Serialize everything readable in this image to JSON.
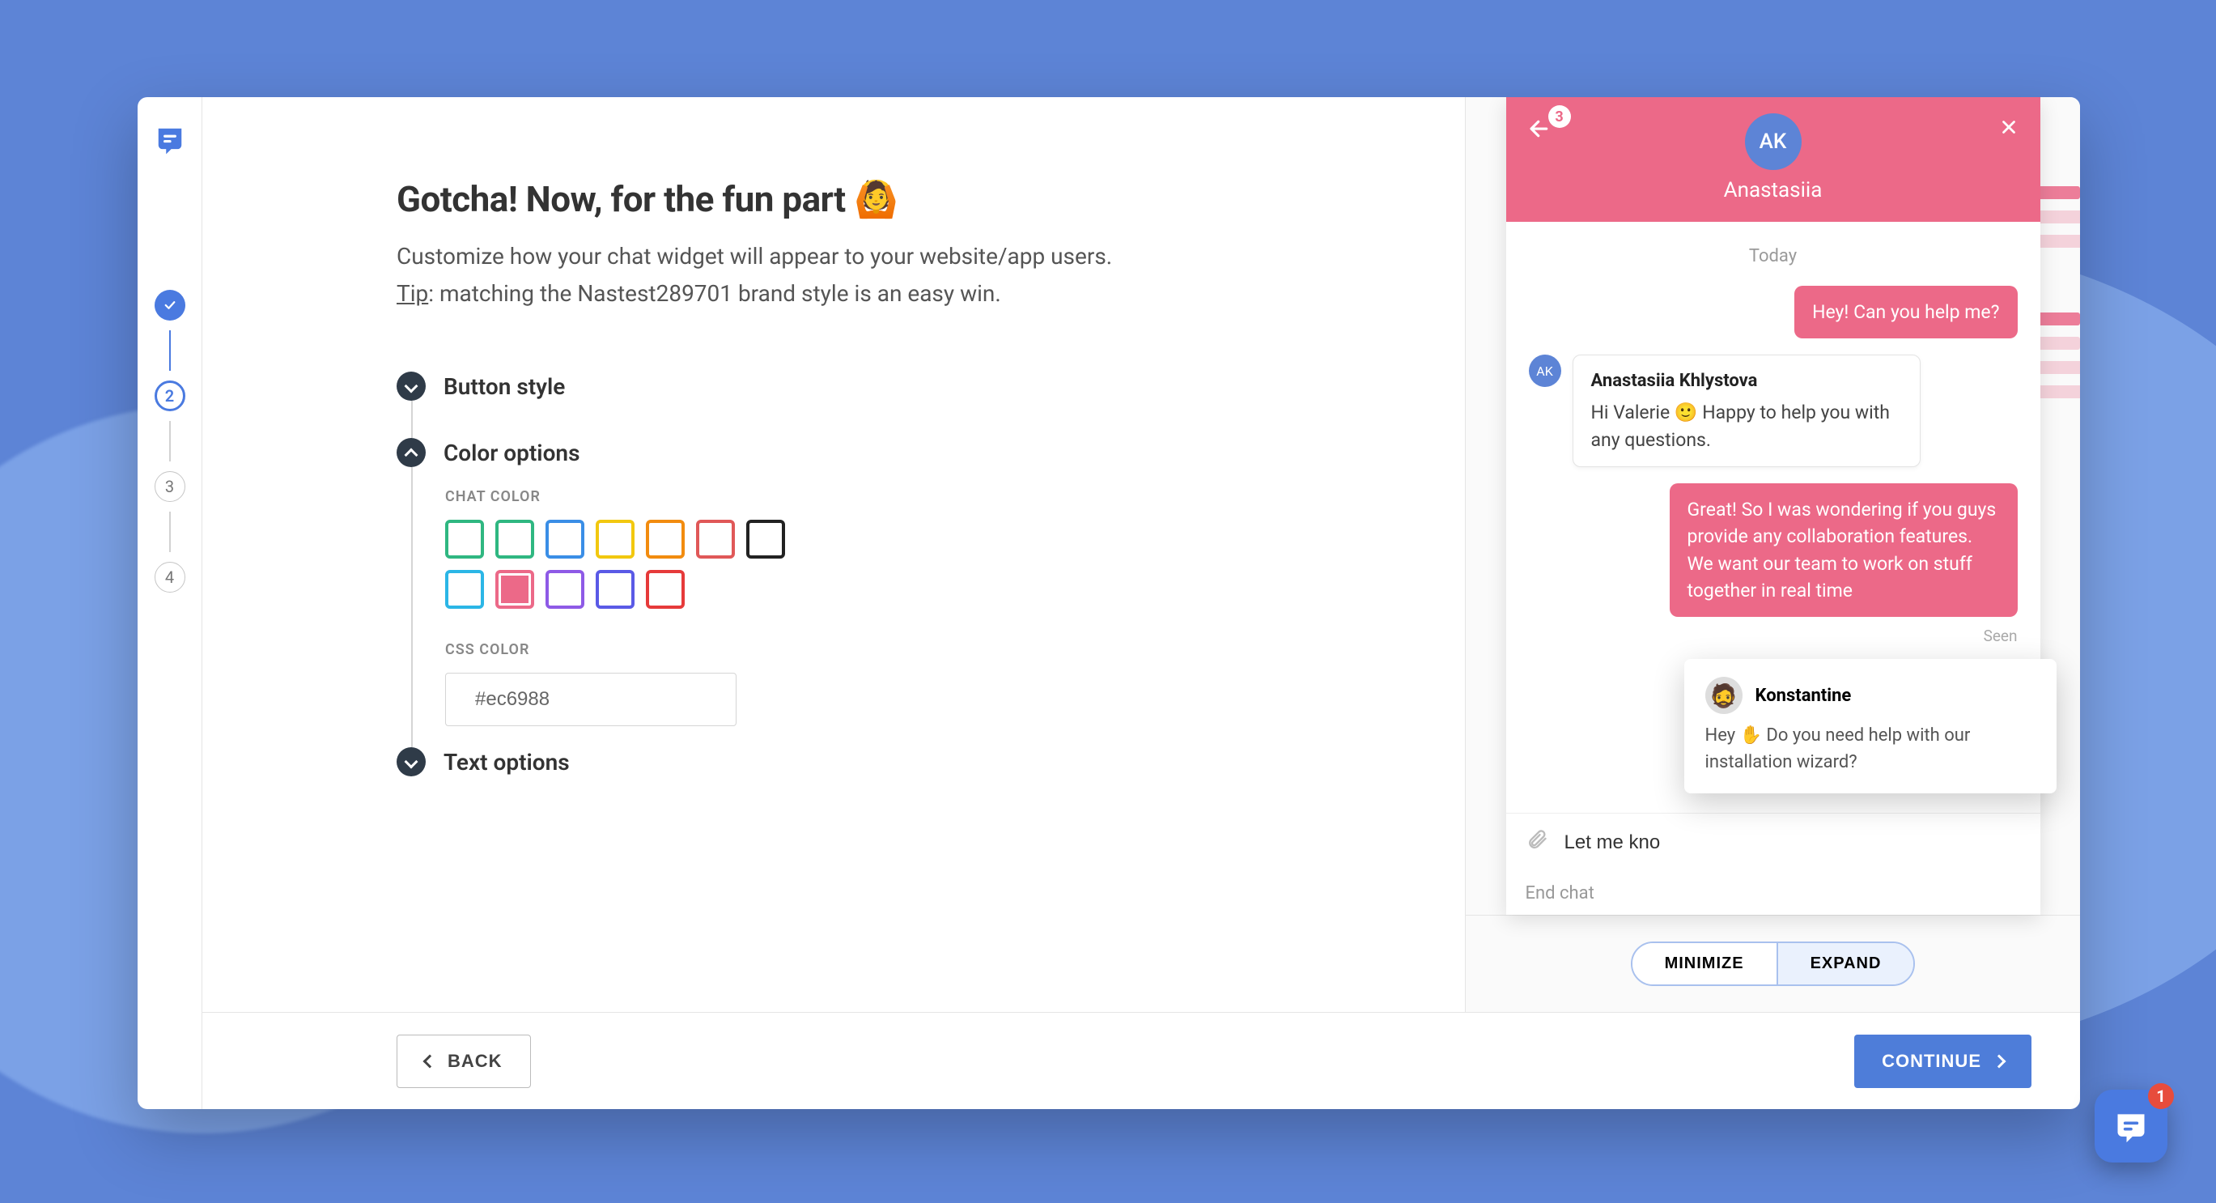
{
  "sidebar": {
    "steps": [
      "1",
      "2",
      "3",
      "4"
    ],
    "current": 2
  },
  "page": {
    "title": "Gotcha! Now, for the fun part 🙆",
    "subtitle": "Customize how your chat widget will appear to your website/app users.",
    "tip_label": "Tip",
    "tip_text": ": matching the Nastest289701 brand style is an easy win."
  },
  "sections": {
    "button_style": {
      "title": "Button style",
      "expanded": false
    },
    "color_options": {
      "title": "Color options",
      "expanded": true,
      "chat_color_label": "CHAT COLOR",
      "css_color_label": "CSS COLOR",
      "swatches": [
        {
          "color": "#2fb781",
          "filled": false
        },
        {
          "color": "#2fb781",
          "filled": false
        },
        {
          "color": "#3a8ee6",
          "filled": false
        },
        {
          "color": "#f2c80f",
          "filled": false
        },
        {
          "color": "#f28c0f",
          "filled": false
        },
        {
          "color": "#e05858",
          "filled": false
        },
        {
          "color": "#222222",
          "filled": false
        },
        {
          "color": "#2bb6e6",
          "filled": false
        },
        {
          "color": "#ec6988",
          "filled": true,
          "selected": true
        },
        {
          "color": "#8e5ae6",
          "filled": false
        },
        {
          "color": "#5a5ae6",
          "filled": false
        },
        {
          "color": "#e63a3a",
          "filled": false
        }
      ],
      "css_value": "#ec6988"
    },
    "text_options": {
      "title": "Text options",
      "expanded": false
    }
  },
  "footer": {
    "back": "BACK",
    "continue": "CONTINUE"
  },
  "preview": {
    "header": {
      "back_badge": "3",
      "avatar": "AK",
      "name": "Anastasiia"
    },
    "day": "Today",
    "messages": [
      {
        "side": "me",
        "text": "Hey! Can you help me?"
      },
      {
        "side": "them",
        "avatar": "AK",
        "author": "Anastasiia Khlystova",
        "text": "Hi Valerie 🙂 Happy to help you with any questions."
      },
      {
        "side": "me",
        "text": "Great! So I was wondering if you guys provide any collaboration features. We want our team to work on stuff together in real time"
      }
    ],
    "seen": "Seen",
    "input_value": "Let me kno",
    "end_chat": "End chat",
    "toast": {
      "name": "Konstantine",
      "text": "Hey ✋ Do you need help with our installation wizard?"
    },
    "controls": {
      "minimize": "MINIMIZE",
      "expand": "EXPAND"
    },
    "fab_badge": "1"
  },
  "colors": {
    "accent": "#ec6988",
    "primary": "#4a7ae0"
  }
}
